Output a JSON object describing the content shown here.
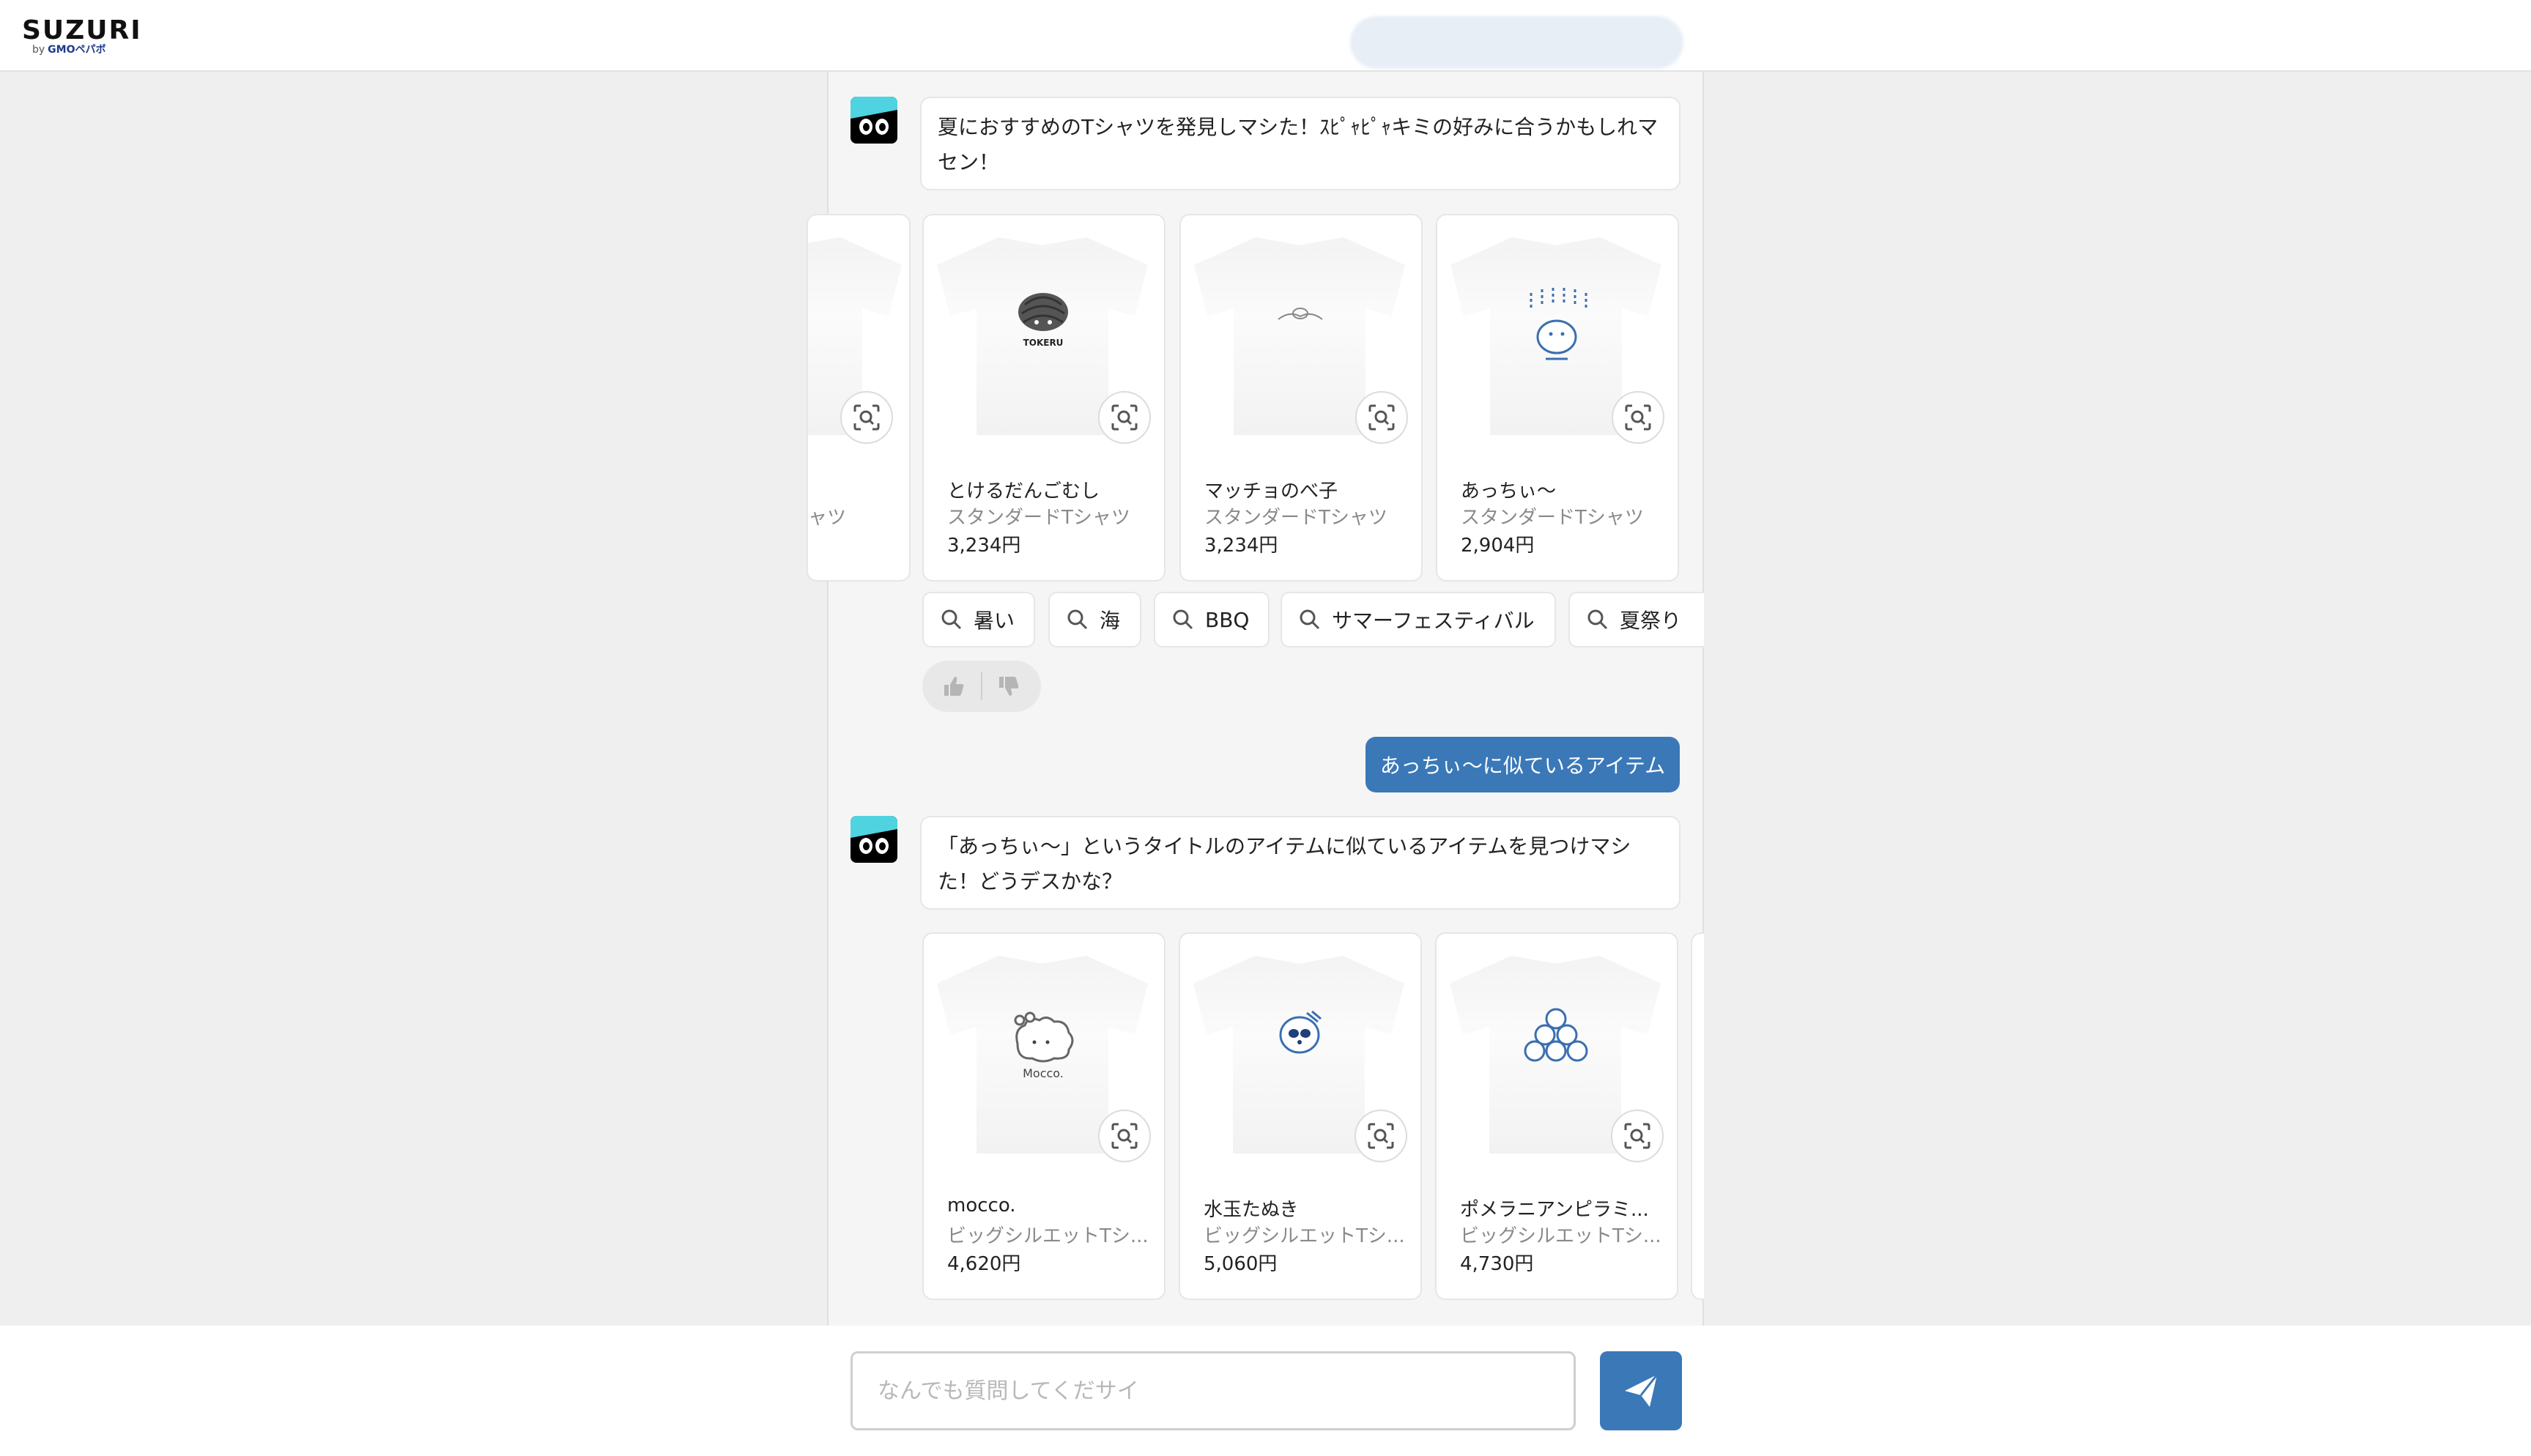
{
  "header": {
    "logo": "SUZURI",
    "logo_sub_by": "by",
    "logo_sub": "GMOペパボ"
  },
  "messages": {
    "bot1_text": "夏におすすめのTシャツを発見しマシた！ｽﾋﾟｬﾋﾟｬキミの好みに合うかもしれマセン！",
    "bot2_text": "「あっちぃ〜」というタイトルのアイテムに似ているアイテムを見つけマシた！どうデスかな？",
    "user_text": "あっちぃ〜に似ているアイテム"
  },
  "carousel1": [
    {
      "title": "",
      "type": "ャツ",
      "price": ""
    },
    {
      "title": "とけるだんごむし",
      "type": "スタンダードTシャツ",
      "price": "3,234円",
      "design": "TOKERU"
    },
    {
      "title": "マッチョのべ子",
      "type": "スタンダードTシャツ",
      "price": "3,234円"
    },
    {
      "title": "あっちぃ〜",
      "type": "スタンダードTシャツ",
      "price": "2,904円"
    }
  ],
  "carousel2": [
    {
      "title": "mocco.",
      "type": "ビッグシルエットTシ...",
      "price": "4,620円",
      "design": "Mocco."
    },
    {
      "title": "水玉たぬき",
      "type": "ビッグシルエットTシ...",
      "price": "5,060円"
    },
    {
      "title": "ポメラニアンピラミ...",
      "type": "ビッグシルエットTシ...",
      "price": "4,730円"
    }
  ],
  "search_chips": [
    "暑い",
    "海",
    "BBQ",
    "サマーフェスティバル",
    "夏祭り"
  ],
  "input": {
    "placeholder": "なんでも質問してくだサイ"
  },
  "colors": {
    "accent": "#3a78b8",
    "avatar_cyan": "#4fd3e0"
  }
}
